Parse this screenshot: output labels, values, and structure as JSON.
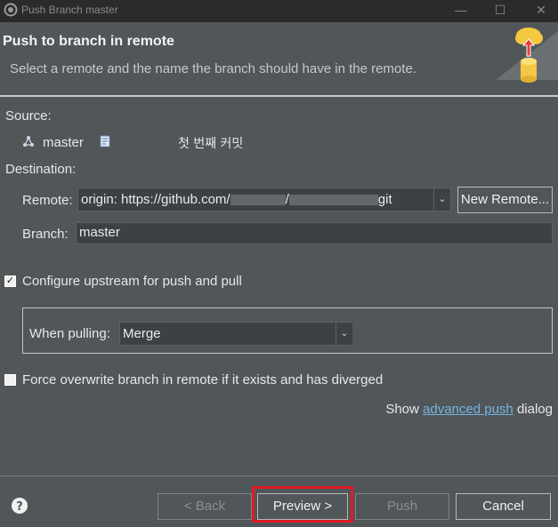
{
  "window": {
    "title": "Push Branch master",
    "app_icon": "eclipse-icon",
    "controls": [
      "minimize-icon",
      "maximize-icon",
      "close-icon"
    ]
  },
  "header": {
    "title": "Push to branch in remote",
    "description": "Select a remote and the name the branch should have in the remote."
  },
  "source": {
    "label": "Source:",
    "branch": "master",
    "commit_message": "첫 번째 커밋"
  },
  "destination": {
    "label": "Destination:",
    "remote_label": "Remote:",
    "remote_value_prefix": "origin: https://github.com/",
    "remote_value_mid": "/",
    "remote_value_suffix": "git",
    "new_remote_label": "New Remote...",
    "branch_label": "Branch:",
    "branch_value": "master"
  },
  "options": {
    "configure_upstream_label": "Configure upstream for push and pull",
    "configure_upstream_checked": true,
    "when_pulling_label": "When pulling:",
    "when_pulling_value": "Merge",
    "force_overwrite_label": "Force overwrite branch in remote if it exists and has diverged",
    "force_overwrite_checked": false,
    "show_text": "Show",
    "advanced_push_link": "advanced push",
    "dialog_text": "dialog"
  },
  "footer": {
    "back_label": "< Back",
    "preview_label": "Preview >",
    "push_label": "Push",
    "cancel_label": "Cancel"
  }
}
